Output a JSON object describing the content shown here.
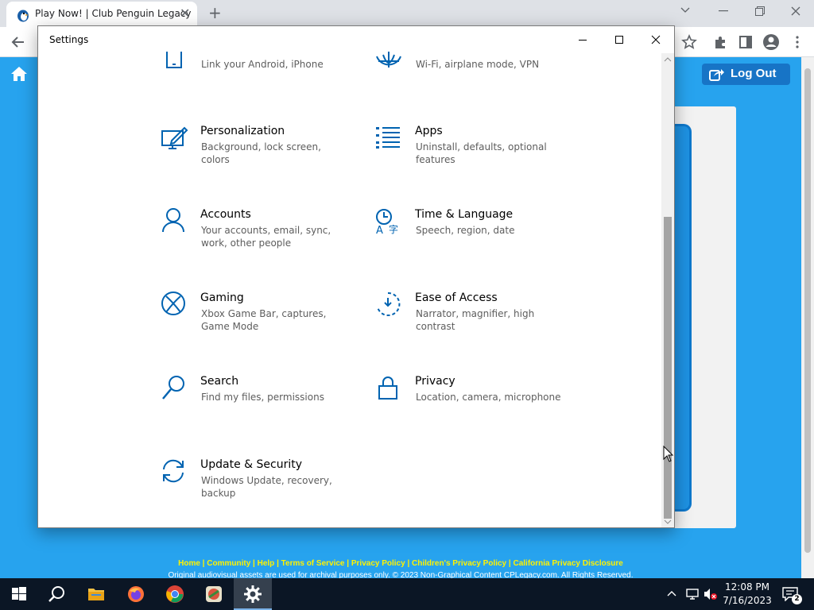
{
  "browser": {
    "tab_title": "Play Now! | Club Penguin Legacy",
    "tab_close": "✕",
    "new_tab": "+"
  },
  "page": {
    "logout_label": "Log Out",
    "footer_links": "Home | Community | Help | Terms of Service | Privacy Policy | Children's Privacy Policy | California Privacy Disclosure",
    "footer_copy": "Original audiovisual assets are used for archival purposes only. © 2023 Non-Graphical Content CPLegacy.com. All Rights Reserved."
  },
  "settings": {
    "title": "Settings",
    "categories": [
      {
        "name": "",
        "desc": "Link your Android, iPhone",
        "icon": "phone-icon"
      },
      {
        "name": "",
        "desc": "Wi-Fi, airplane mode, VPN",
        "icon": "globe-icon"
      },
      {
        "name": "Personalization",
        "desc": "Background, lock screen, colors",
        "icon": "personalization-icon"
      },
      {
        "name": "Apps",
        "desc": "Uninstall, defaults, optional features",
        "icon": "apps-icon"
      },
      {
        "name": "Accounts",
        "desc": "Your accounts, email, sync, work, other people",
        "icon": "person-icon"
      },
      {
        "name": "Time & Language",
        "desc": "Speech, region, date",
        "icon": "time-language-icon"
      },
      {
        "name": "Gaming",
        "desc": "Xbox Game Bar, captures, Game Mode",
        "icon": "xbox-icon"
      },
      {
        "name": "Ease of Access",
        "desc": "Narrator, magnifier, high contrast",
        "icon": "ease-of-access-icon"
      },
      {
        "name": "Search",
        "desc": "Find my files, permissions",
        "icon": "search-icon"
      },
      {
        "name": "Privacy",
        "desc": "Location, camera, microphone",
        "icon": "lock-icon"
      },
      {
        "name": "Update & Security",
        "desc": "Windows Update, recovery, backup",
        "icon": "update-icon"
      }
    ]
  },
  "taskbar": {
    "time": "12:08 PM",
    "date": "7/16/2023",
    "notification_count": "2"
  },
  "colors": {
    "accent": "#0063b1",
    "page_bg": "#27a3ee",
    "taskbar_bg": "#0b1625"
  }
}
